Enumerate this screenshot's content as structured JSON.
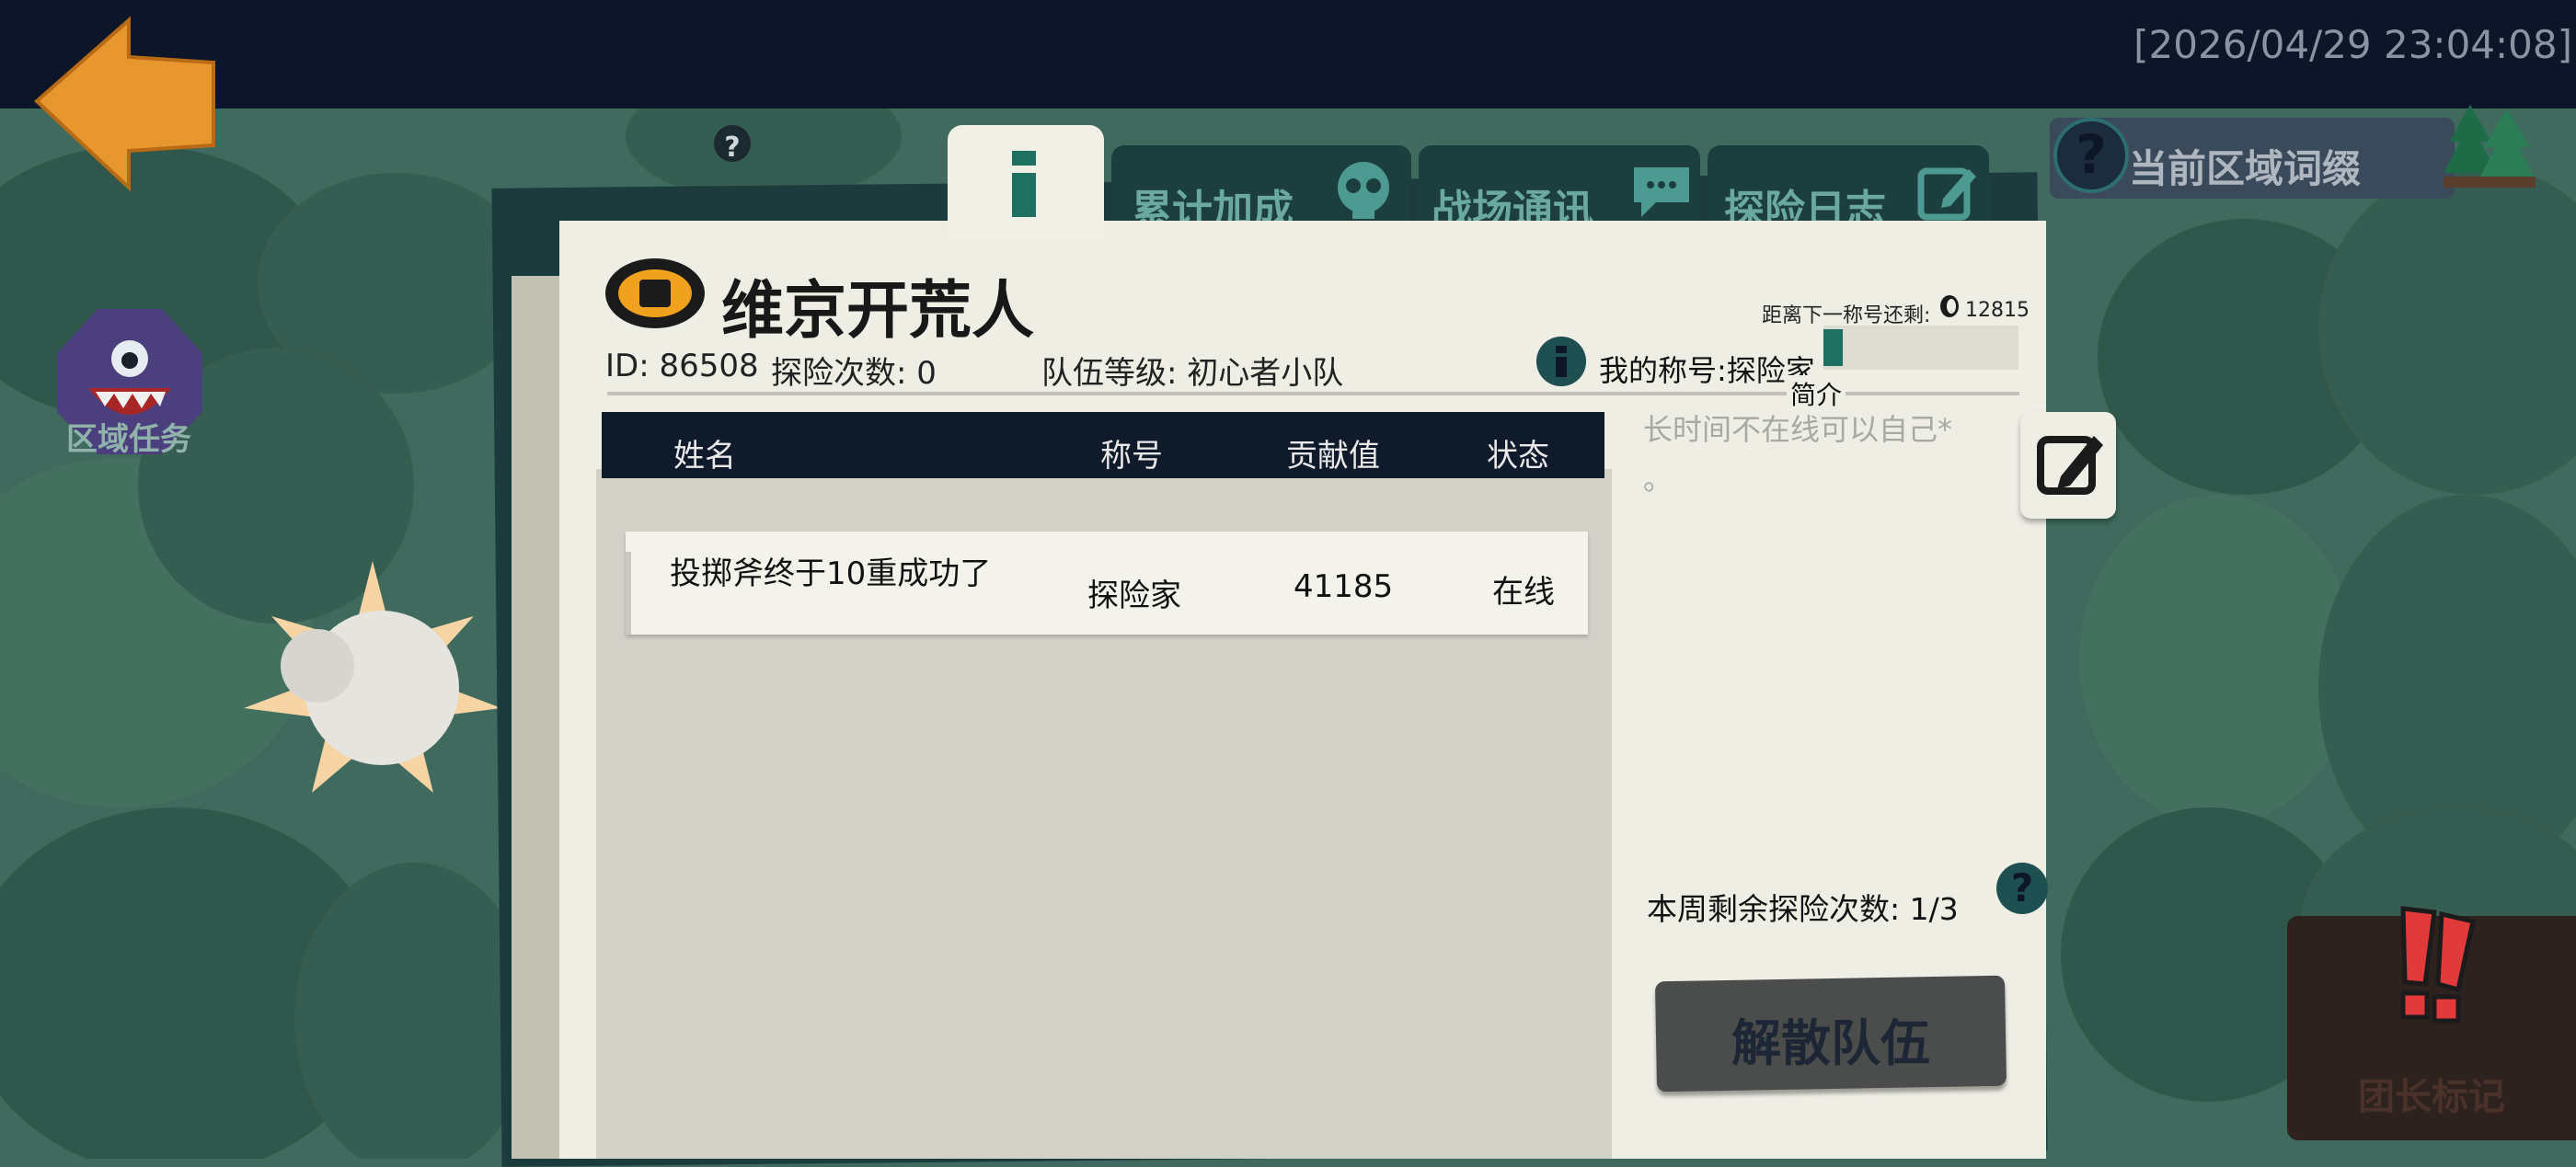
{
  "timestamp": "[2026/04/29 23:04:08]",
  "sidebar": {
    "region_task_label": "区域任务"
  },
  "area": {
    "label": "当前区域词缀"
  },
  "tabs": [
    {
      "label": "累计加成"
    },
    {
      "label": "战场通讯"
    },
    {
      "label": "探险日志"
    }
  ],
  "team": {
    "name": "维京开荒人",
    "id_text": "ID: 86508",
    "explore_count_text": "探险次数: 0",
    "level_text": "队伍等级: 初心者小队",
    "next_title_text": "距离下一称号还剩:",
    "next_title_value": "12815",
    "my_title_text": "我的称号:探险家",
    "title_progress": 0.1,
    "intro_label": "简介",
    "bio_line1": "长时间不在线可以自己*",
    "bio_line2": "。",
    "weekly_text": "本周剩余探险次数:  1/3"
  },
  "table": {
    "headers": [
      "姓名",
      "称号",
      "贡献值",
      "状态"
    ],
    "rows": [
      {
        "name": "投掷斧终于10重成功了",
        "title": "探险家",
        "contribution": "41185",
        "status": "在线"
      }
    ]
  },
  "buttons": {
    "disband": "解散队伍",
    "leader_mark": "团长标记"
  },
  "colors": {
    "topbar": "#0c1628",
    "accent_teal": "#1f7061",
    "back_arrow": "#e8962e",
    "leader_red": "#e23a3a"
  }
}
